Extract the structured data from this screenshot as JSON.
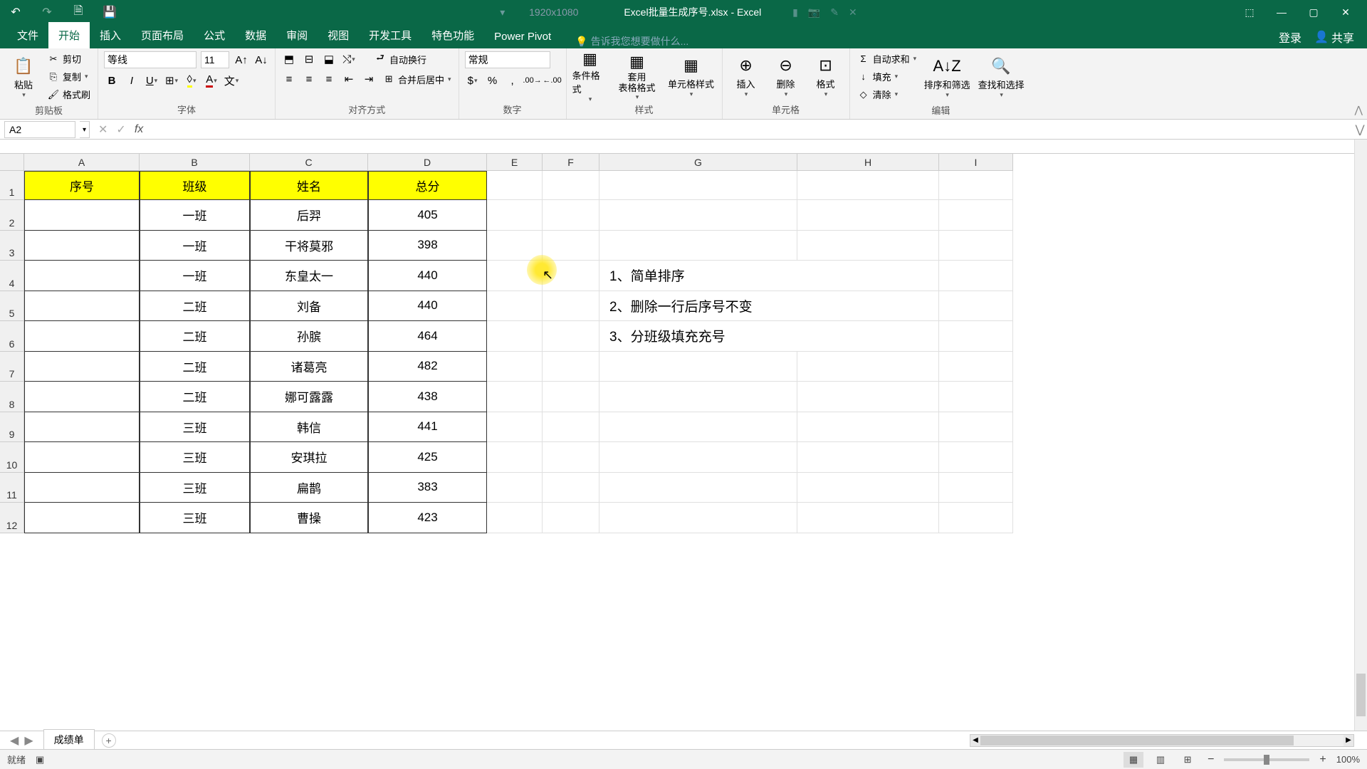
{
  "title": {
    "resolution": "1920x1080",
    "filename": "Excel批量生成序号.xlsx - Excel"
  },
  "tabs": {
    "file": "文件",
    "home": "开始",
    "insert": "插入",
    "pagelayout": "页面布局",
    "formulas": "公式",
    "data": "数据",
    "review": "审阅",
    "view": "视图",
    "developer": "开发工具",
    "special": "特色功能",
    "powerpivot": "Power Pivot",
    "tellme": "告诉我您想要做什么...",
    "login": "登录",
    "share": "共享"
  },
  "ribbon": {
    "clipboard": {
      "paste": "粘贴",
      "cut": "剪切",
      "copy": "复制",
      "formatpainter": "格式刷",
      "label": "剪贴板"
    },
    "font": {
      "name": "等线",
      "size": "11",
      "label": "字体"
    },
    "alignment": {
      "wrap": "自动换行",
      "merge": "合并后居中",
      "label": "对齐方式"
    },
    "number": {
      "format": "常规",
      "label": "数字"
    },
    "styles": {
      "conditional": "条件格式",
      "table": "套用\n表格格式",
      "cellstyles": "单元格样式",
      "label": "样式"
    },
    "cells": {
      "insert": "插入",
      "delete": "删除",
      "format": "格式",
      "label": "单元格"
    },
    "editing": {
      "autosum": "自动求和",
      "fill": "填充",
      "clear": "清除",
      "sort": "排序和筛选",
      "find": "查找和选择",
      "label": "编辑"
    }
  },
  "formula_bar": {
    "name_box": "A2",
    "formula": ""
  },
  "columns": [
    "A",
    "B",
    "C",
    "D",
    "E",
    "F",
    "G",
    "H",
    "I"
  ],
  "rows": [
    "1",
    "2",
    "3",
    "4",
    "5",
    "6",
    "7",
    "8",
    "9",
    "10",
    "11",
    "12"
  ],
  "table": {
    "headers": [
      "序号",
      "班级",
      "姓名",
      "总分"
    ],
    "data": [
      [
        "",
        "一班",
        "后羿",
        "405"
      ],
      [
        "",
        "一班",
        "干将莫邪",
        "398"
      ],
      [
        "",
        "一班",
        "东皇太一",
        "440"
      ],
      [
        "",
        "二班",
        "刘备",
        "440"
      ],
      [
        "",
        "二班",
        "孙膑",
        "464"
      ],
      [
        "",
        "二班",
        "诸葛亮",
        "482"
      ],
      [
        "",
        "二班",
        "娜可露露",
        "438"
      ],
      [
        "",
        "三班",
        "韩信",
        "441"
      ],
      [
        "",
        "三班",
        "安琪拉",
        "425"
      ],
      [
        "",
        "三班",
        "扁鹊",
        "383"
      ],
      [
        "",
        "三班",
        "曹操",
        "423"
      ]
    ]
  },
  "notes": [
    "1、简单排序",
    "2、删除一行后序号不变",
    "3、分班级填充充号"
  ],
  "sheet": {
    "name": "成绩单"
  },
  "status": {
    "ready": "就绪",
    "zoom": "100%"
  }
}
